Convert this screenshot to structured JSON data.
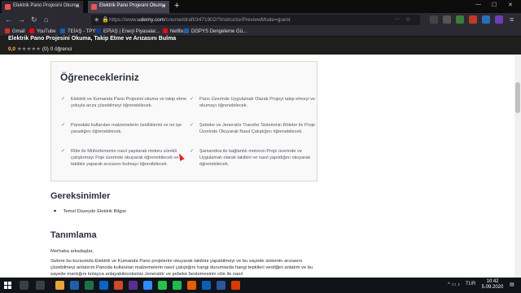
{
  "browser": {
    "tabs": [
      {
        "label": "Elektrik Pano Projesini Okuma"
      },
      {
        "label": "Elektrik Pano Projesini Okuma"
      }
    ],
    "url_prefix": "https://www.",
    "url_domain": "udemy.com",
    "url_path": "/course/draft/3471902/?instructorPreviewMode=guest",
    "bookmarks": [
      {
        "label": "Gmail",
        "color": "#d93025"
      },
      {
        "label": "YouTube",
        "color": "#ff0000"
      },
      {
        "label": "TEİAŞ - TPYS",
        "color": "#1a5fb4"
      },
      {
        "label": "EPİAŞ | Enerji Piyasalar...",
        "color": "#0b3d91"
      },
      {
        "label": "Netflix",
        "color": "#e50914"
      },
      {
        "label": "DGPYS Dengeleme Gü...",
        "color": "#1a5fb4"
      }
    ]
  },
  "course": {
    "title": "Elektrik Pano Projesini Okuma, Takip Etme ve Arızasını Bulma",
    "rating": "0,0",
    "rating_count": "(0)",
    "students": "0 öğrenci"
  },
  "learn": {
    "heading": "Öğrenecekleriniz",
    "items": [
      "Elektrik ve Kumanda Pano Projesini okuma ve takip etme yoluyla arıza çözebilmeyi öğrenebilecek.",
      "Pano Üzerinde Uygulamalı Olarak Projeyi takip etmeyi ve okumayı öğrenebilecek.",
      "Panodaki kullanılan malzemelerin özelliklerini ve ne işe yaradığını öğrenebilecek.",
      "Şebeke ve Jeneratör Transfer Sisteminin Röleler ile Proje Üzerinde Okuyarak Nasıl Çalıştığını öğrenebilecek.",
      "Röle ile Mühürlemenin nasıl yapılarak motoru sürekli çalıştırmayı Poje üzerinde okuyarak öğrenebilecek ve takibini yaparak arızasını bulmayı öğrenibilecek.",
      "Şamandıra ile bağlantılı motorun Proje üzerinde ve Uygulamalı olarak takibini ve nasıl yapıldığını okuyarak öğrenebilecek."
    ]
  },
  "requirements": {
    "heading": "Gereksinimler",
    "items": [
      "Temel Düzeyde Elektrik Bilgisi"
    ]
  },
  "description": {
    "heading": "Tanımlama",
    "p1": "Merhaba arkadaşlar,",
    "p2": "Sizlere bu kursumda Elektrik ve Kumanda Pano projelerini okuyarak takibini yapabilmeyi ve bu sayede sistemin arızasını çözebilmeyi anlatırım.Panoda kullanılan malzemelerin nasıl çalıştığını hangi durumlarda hangi tepkileri verdiğini anlatım ve bu sayede mantığını kolayca anlayabileceksiniz.Jeneratör ve şebeke beslemesinin röle ile nasıl"
  },
  "taskbar": {
    "tray_lang": "TUR",
    "time": "10:42",
    "date": "5.09.2020"
  }
}
